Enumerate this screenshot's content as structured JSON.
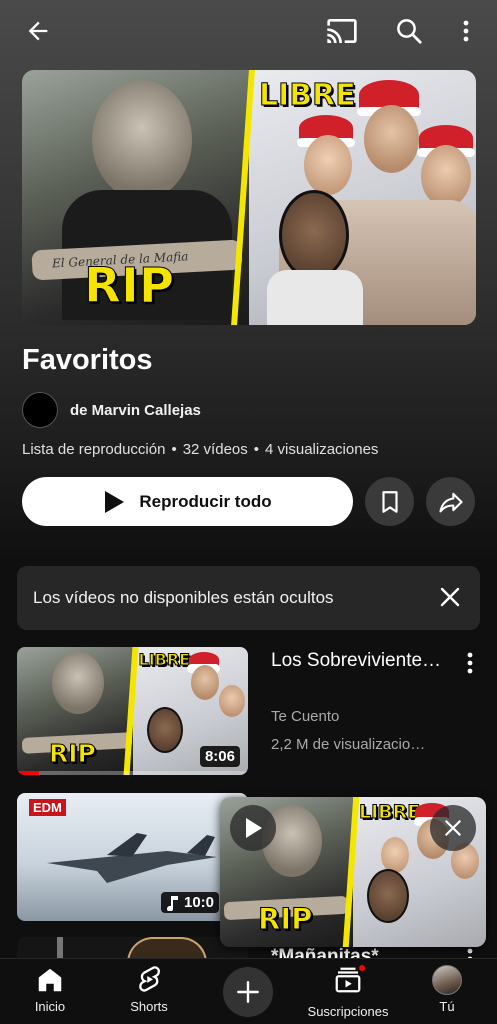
{
  "header": {
    "back_icon": "arrow-left-icon",
    "cast_icon": "cast-icon",
    "search_icon": "search-icon",
    "more_icon": "more-vertical-icon"
  },
  "playlist": {
    "thumbnail": {
      "left_caption": "RIP",
      "right_caption": "LIBRE",
      "tattoo_text": "El General de la Mafia"
    },
    "title": "Favoritos",
    "owner": "de Marvin Callejas",
    "type": "Lista de reproducción",
    "video_count": "32 vídeos",
    "views": "4 visualizaciones",
    "separator": "•",
    "play_all_label": "Reproducir todo",
    "save_icon": "bookmark-icon",
    "share_icon": "share-icon"
  },
  "notice": {
    "text": "Los vídeos no disponibles están ocultos",
    "close_icon": "close-icon"
  },
  "videos": [
    {
      "title": "Los Sobreviviente…",
      "channel": "Te Cuento",
      "views": "2,2 M de visualizacio…",
      "duration": "8:06",
      "thumb_left": "RIP",
      "thumb_right": "LIBRE"
    },
    {
      "duration": "10:0",
      "thumb_logo": "EDM"
    },
    {
      "title": "*Mañanitas*"
    }
  ],
  "miniplayer": {
    "left_caption": "RIP",
    "right_caption": "LIBRE",
    "play_icon": "play-icon",
    "close_icon": "close-icon"
  },
  "bottom_nav": {
    "items": [
      {
        "label": "Inicio",
        "icon": "home-icon"
      },
      {
        "label": "Shorts",
        "icon": "shorts-icon"
      },
      {
        "label": "",
        "icon": "plus-icon"
      },
      {
        "label": "Suscripciones",
        "icon": "subscriptions-icon"
      },
      {
        "label": "Tú",
        "icon": "avatar"
      }
    ]
  },
  "colors": {
    "background": "#0f0f0f",
    "accent_red": "#ff0000",
    "thumb_yellow": "#f5e400",
    "button_white": "#ffffff",
    "chip_gray": "#272727"
  }
}
